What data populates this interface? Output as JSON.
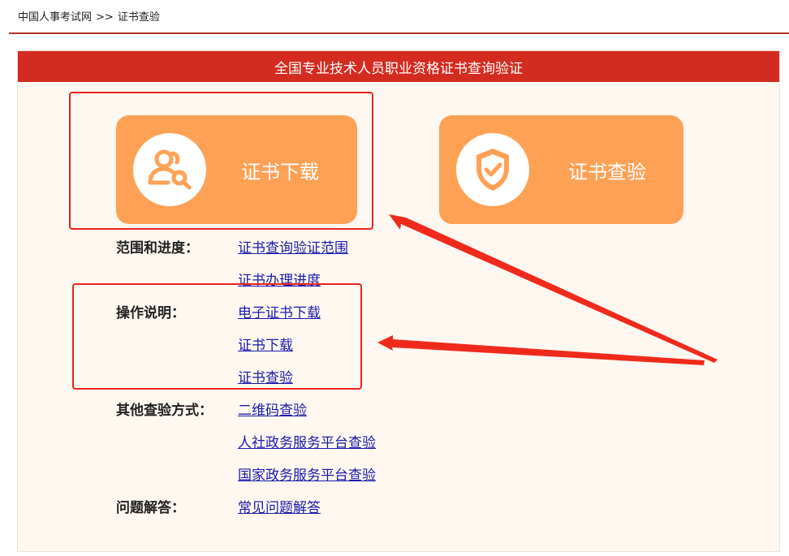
{
  "breadcrumb": {
    "home": "中国人事考试网",
    "separator": ">>",
    "current": "证书查验"
  },
  "panel": {
    "title": "全国专业技术人员职业资格证书查询验证"
  },
  "cards": {
    "download_label": "证书下载",
    "verify_label": "证书查验"
  },
  "sections": {
    "scope": {
      "label": "范围和进度：",
      "links": [
        "证书查询验证范围",
        "证书办理进度"
      ]
    },
    "instructions": {
      "label": "操作说明：",
      "links": [
        "电子证书下载",
        "证书下载",
        "证书查验"
      ]
    },
    "other": {
      "label": "其他查验方式：",
      "links": [
        "二维码查验",
        "人社政务服务平台查验",
        "国家政务服务平台查验"
      ]
    },
    "faq": {
      "label": "问题解答：",
      "links": [
        "常见问题解答"
      ]
    }
  },
  "colors": {
    "header_red": "#d42b20",
    "card_orange": "#ffa155",
    "link_blue": "#1a1aaa",
    "annotation_red": "#e8231b",
    "panel_bg": "#fff8f1"
  }
}
